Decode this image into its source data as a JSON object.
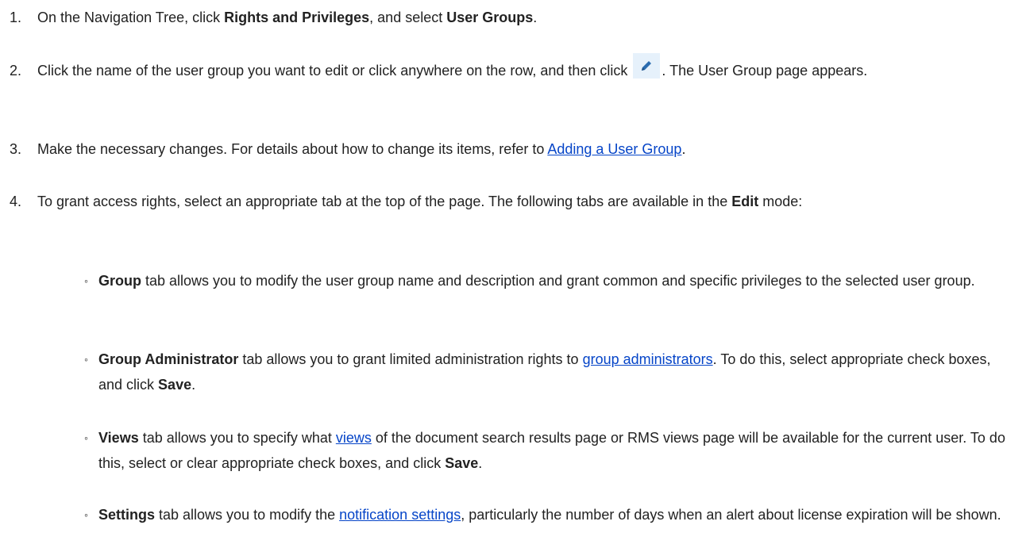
{
  "steps": [
    {
      "num": "1.",
      "pre": "On the Navigation Tree, click ",
      "bold1": "Rights and Privileges",
      "mid": ", and select ",
      "bold2": "User Groups",
      "post": "."
    },
    {
      "num": "2.",
      "pre": "Click the name of the user group you want to edit or click anywhere on the row, and then click",
      "icon": "pencil-edit-icon",
      "post": ". The User Group page appears."
    },
    {
      "num": "3.",
      "pre": "Make the necessary changes. For details about how to change its items, refer to ",
      "link": "Adding a User Group",
      "post": "."
    },
    {
      "num": "4.",
      "pre": "To grant access rights, select an appropriate tab at the top of the page. The following tabs are available in the ",
      "bold": "Edit",
      "post": " mode:"
    }
  ],
  "bullets": [
    {
      "mark": "◦",
      "bold": "Group",
      "text": " tab allows you to modify the user group name and description and grant common and specific privileges to the selected user group."
    },
    {
      "mark": "◦",
      "bold": "Group Administrator",
      "pre": " tab allows you to grant limited administration rights to ",
      "link": "group administrators",
      "mid": ". To do this, select appropriate check boxes, and click ",
      "bold2": "Save",
      "post": "."
    },
    {
      "mark": "◦",
      "bold": "Views",
      "pre": " tab allows you to specify what ",
      "link": "views",
      "mid": " of the document search results page or RMS views page will be available for the current user. To do this, select or clear appropriate check boxes, and click ",
      "bold2": "Save",
      "post": "."
    },
    {
      "mark": "◦",
      "bold": "Settings",
      "pre": " tab allows you to modify the ",
      "link": "notification settings",
      "post": ", particularly the number of days when an alert about license expiration will be shown."
    }
  ],
  "colors": {
    "text": "#222222",
    "link": "#0645c8",
    "icon_bg": "#e6f1fb",
    "icon_fg": "#2b6cb0"
  }
}
